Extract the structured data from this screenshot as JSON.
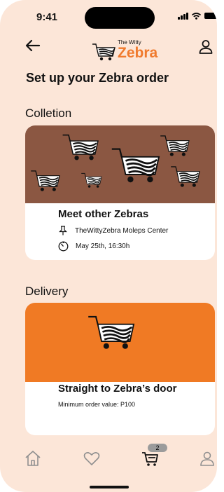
{
  "status_bar": {
    "time": "9:41"
  },
  "header": {
    "logo_small": "The Witty",
    "logo_big": "Zebra"
  },
  "page_title": "Set up your Zebra order",
  "sections": {
    "collection": {
      "title": "Colletion",
      "card_title": "Meet other Zebras",
      "location": "TheWittyZebra Moleps Center",
      "datetime": "May 25th, 16:30h"
    },
    "delivery": {
      "title": "Delivery",
      "card_title": "Straight to Zebra’s door",
      "min_order": "Minimum order value: P100"
    }
  },
  "tabbar": {
    "items": [
      {
        "icon": "home-icon"
      },
      {
        "icon": "heart-icon"
      },
      {
        "icon": "cart-icon",
        "badge": "2"
      },
      {
        "icon": "profile-icon"
      }
    ]
  },
  "colors": {
    "background": "#fce6d8",
    "brand_orange": "#f07a24",
    "collection_hero": "#8b5742",
    "card": "#ffffff"
  }
}
